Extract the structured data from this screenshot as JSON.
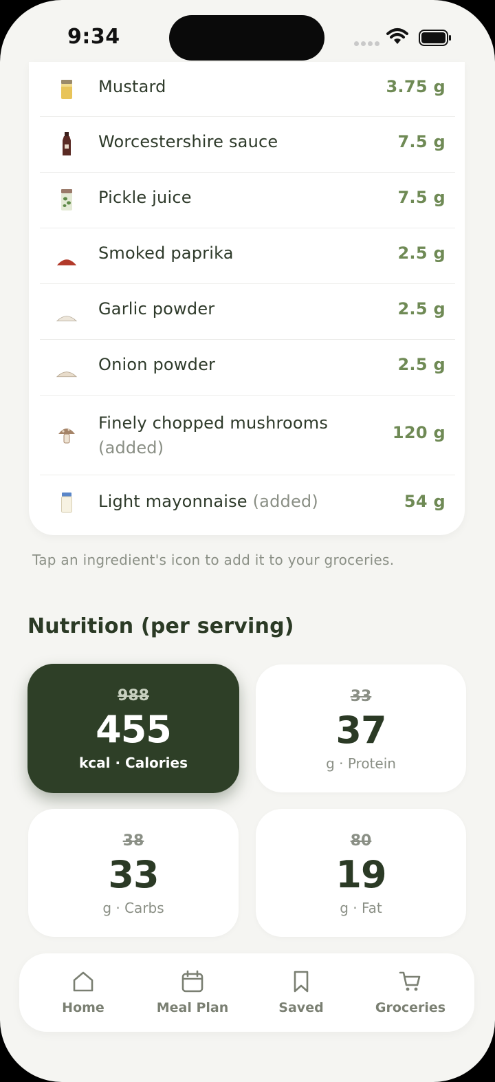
{
  "status": {
    "time": "9:34"
  },
  "ingredients": [
    {
      "name": "Mustard",
      "note": "",
      "qty": "3.75 g",
      "icon": "mustard-jar-icon"
    },
    {
      "name": "Worcestershire sauce",
      "note": "",
      "qty": "7.5 g",
      "icon": "sauce-bottle-icon"
    },
    {
      "name": "Pickle juice",
      "note": "",
      "qty": "7.5 g",
      "icon": "pickle-jar-icon"
    },
    {
      "name": "Smoked paprika",
      "note": "",
      "qty": "2.5 g",
      "icon": "paprika-pile-icon"
    },
    {
      "name": "Garlic powder",
      "note": "",
      "qty": "2.5 g",
      "icon": "powder-pile-icon"
    },
    {
      "name": "Onion powder",
      "note": "",
      "qty": "2.5 g",
      "icon": "powder-pile-icon"
    },
    {
      "name": "Finely chopped mushrooms",
      "note": "(added)",
      "qty": "120 g",
      "icon": "mushroom-icon"
    },
    {
      "name": "Light mayonnaise",
      "note": "(added)",
      "qty": "54 g",
      "icon": "mayonnaise-jar-icon"
    }
  ],
  "tip": "Tap an ingredient's icon to add it to your groceries.",
  "nutrition": {
    "title": "Nutrition (per serving)",
    "tiles": [
      {
        "old": "988",
        "value": "455",
        "unit": "kcal · Calories"
      },
      {
        "old": "33",
        "value": "37",
        "unit": "g · Protein"
      },
      {
        "old": "38",
        "value": "33",
        "unit": "g · Carbs"
      },
      {
        "old": "80",
        "value": "19",
        "unit": "g · Fat"
      }
    ]
  },
  "tabs": [
    {
      "label": "Home",
      "icon": "home-icon"
    },
    {
      "label": "Meal Plan",
      "icon": "calendar-icon"
    },
    {
      "label": "Saved",
      "icon": "bookmark-icon"
    },
    {
      "label": "Groceries",
      "icon": "cart-icon"
    }
  ],
  "colors": {
    "accent_dark": "#2e3f27",
    "qty_green": "#6f8a55",
    "background": "#f5f5f2"
  }
}
